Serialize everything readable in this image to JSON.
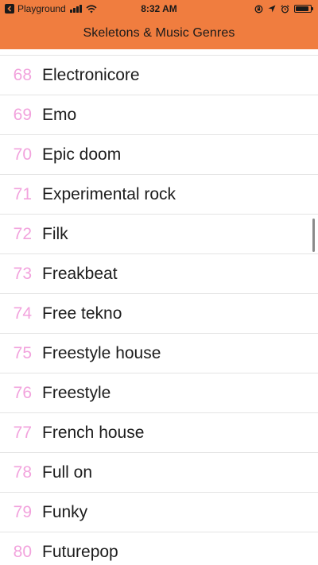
{
  "status_bar": {
    "carrier": "Playground",
    "time": "8:32 AM",
    "battery_level": 0.9
  },
  "nav": {
    "title": "Skeletons & Music Genres"
  },
  "list": {
    "items": [
      {
        "number": "68",
        "label": "Electronicore"
      },
      {
        "number": "69",
        "label": "Emo"
      },
      {
        "number": "70",
        "label": "Epic doom"
      },
      {
        "number": "71",
        "label": "Experimental rock"
      },
      {
        "number": "72",
        "label": "Filk"
      },
      {
        "number": "73",
        "label": "Freakbeat"
      },
      {
        "number": "74",
        "label": "Free tekno"
      },
      {
        "number": "75",
        "label": "Freestyle house"
      },
      {
        "number": "76",
        "label": "Freestyle"
      },
      {
        "number": "77",
        "label": "French house"
      },
      {
        "number": "78",
        "label": "Full on"
      },
      {
        "number": "79",
        "label": "Funky"
      },
      {
        "number": "80",
        "label": "Futurepop"
      }
    ]
  },
  "colors": {
    "header_background": "#f07d3f",
    "number_color": "#f2a3dd",
    "label_color": "#1c1c1c",
    "separator": "#e4e4e4"
  },
  "icons": [
    "back-to-app-icon",
    "cellular-signal-icon",
    "wifi-icon",
    "rotation-lock-icon",
    "location-icon",
    "alarm-icon",
    "battery-icon"
  ]
}
